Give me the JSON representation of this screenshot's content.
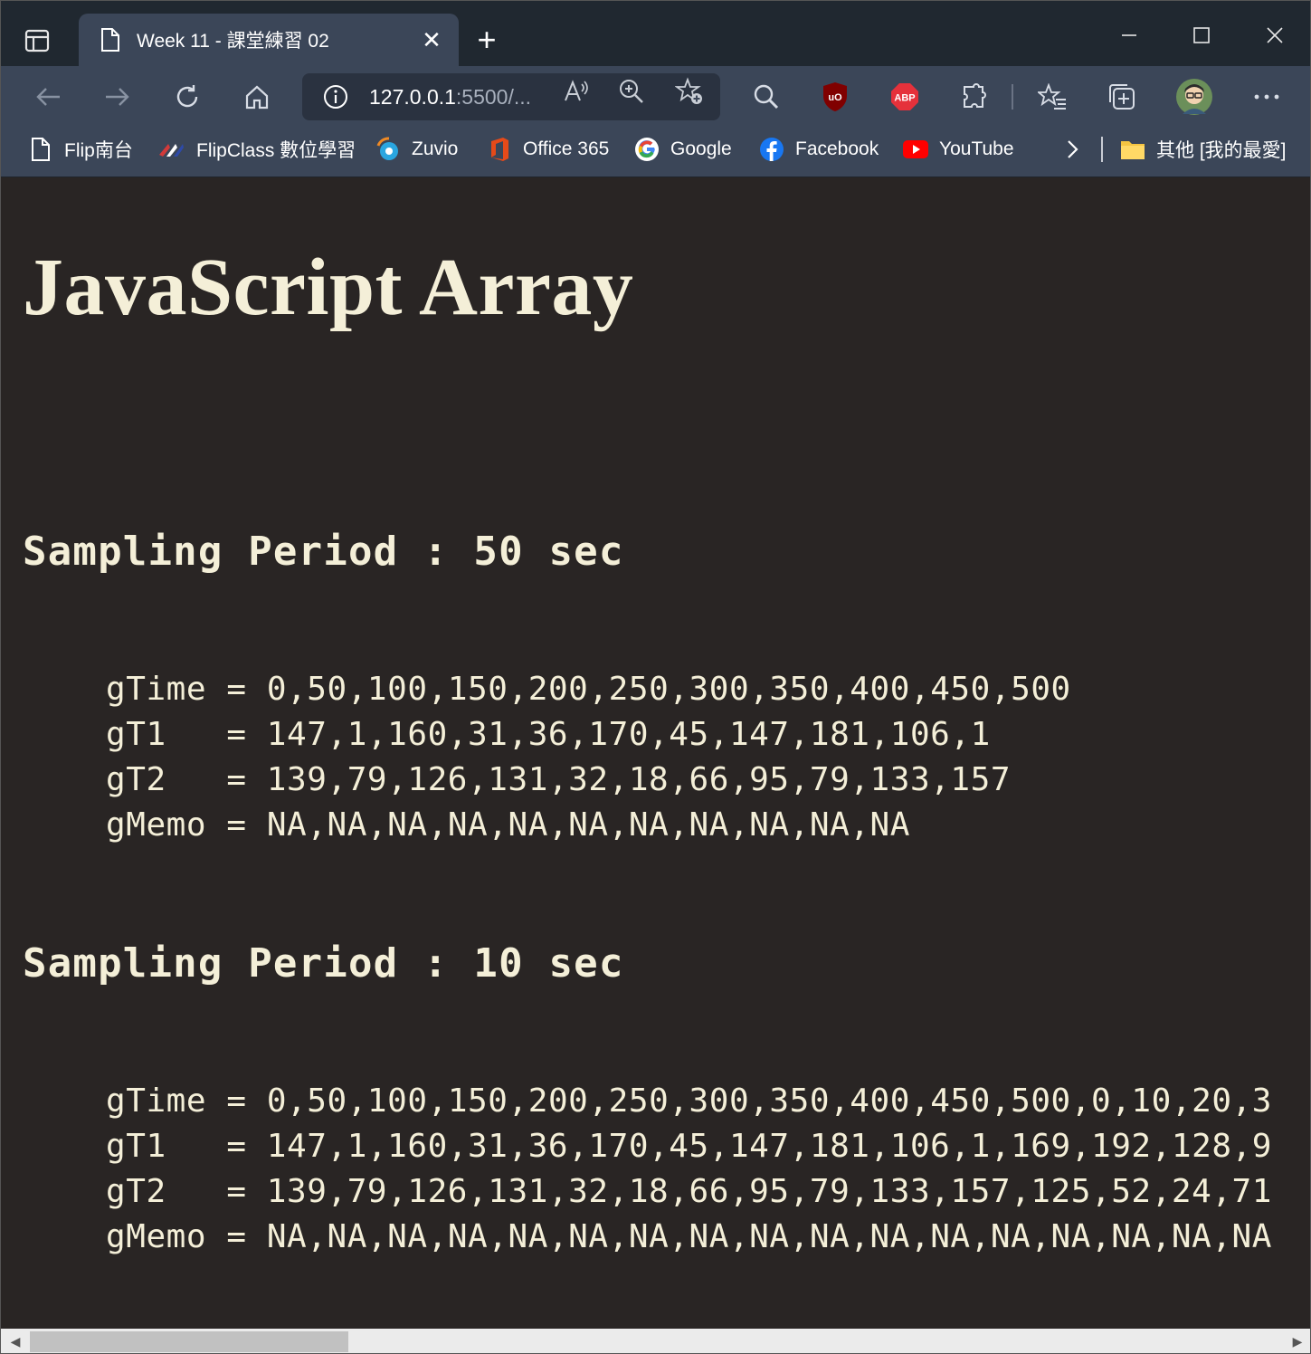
{
  "browser": {
    "tab_title": "Week 11 - 課堂練習 02",
    "url_host": "127.0.0.1",
    "url_rest": ":5500/...",
    "bookmarks": [
      {
        "label": "Flip南台",
        "icon": "page-icon"
      },
      {
        "label": "FlipClass 數位學習",
        "icon": "flipclass-icon"
      },
      {
        "label": "Zuvio",
        "icon": "zuvio-icon"
      },
      {
        "label": "Office 365",
        "icon": "office-icon"
      },
      {
        "label": "Google",
        "icon": "google-icon"
      },
      {
        "label": "Facebook",
        "icon": "facebook-icon"
      },
      {
        "label": "YouTube",
        "icon": "youtube-icon"
      }
    ],
    "other_bookmarks": "其他 [我的最愛]",
    "extensions": {
      "ublock": "uO",
      "abp": "ABP"
    }
  },
  "page": {
    "title": "JavaScript Array",
    "sections": [
      {
        "heading": "Sampling Period : 50 sec",
        "rows": [
          {
            "name": "gTime",
            "pad": " ",
            "value": "0,50,100,150,200,250,300,350,400,450,500"
          },
          {
            "name": "gT1",
            "pad": "   ",
            "value": "147,1,160,31,36,170,45,147,181,106,1"
          },
          {
            "name": "gT2",
            "pad": "   ",
            "value": "139,79,126,131,32,18,66,95,79,133,157"
          },
          {
            "name": "gMemo",
            "pad": " ",
            "value": "NA,NA,NA,NA,NA,NA,NA,NA,NA,NA,NA"
          }
        ]
      },
      {
        "heading": "Sampling Period : 10 sec",
        "rows": [
          {
            "name": "gTime",
            "pad": " ",
            "value": "0,50,100,150,200,250,300,350,400,450,500,0,10,20,3"
          },
          {
            "name": "gT1",
            "pad": "   ",
            "value": "147,1,160,31,36,170,45,147,181,106,1,169,192,128,9"
          },
          {
            "name": "gT2",
            "pad": "   ",
            "value": "139,79,126,131,32,18,66,95,79,133,157,125,52,24,71"
          },
          {
            "name": "gMemo",
            "pad": " ",
            "value": "NA,NA,NA,NA,NA,NA,NA,NA,NA,NA,NA,NA,NA,NA,NA,NA,NA"
          }
        ]
      }
    ]
  }
}
